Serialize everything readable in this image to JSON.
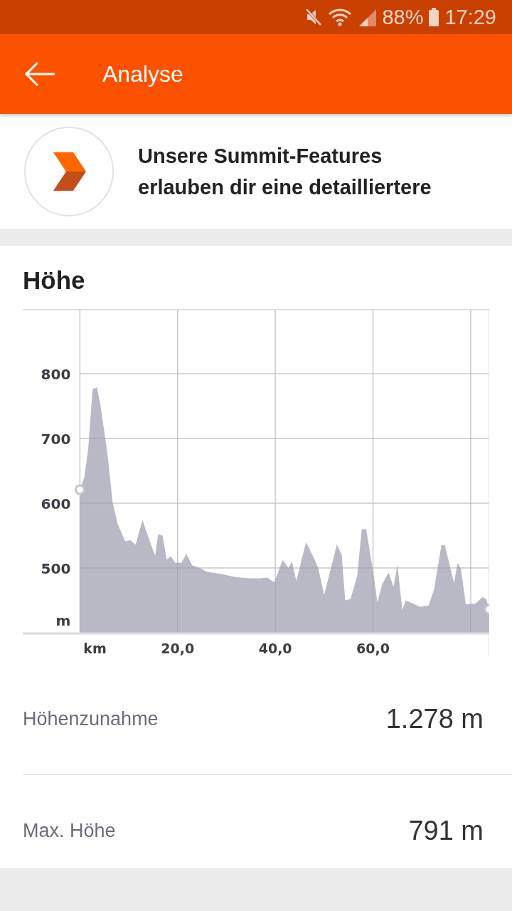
{
  "status_bar": {
    "battery": "88%",
    "time": "17:29"
  },
  "app_bar": {
    "title": "Analyse"
  },
  "promo": {
    "text": "Unsere Summit-Features erlauben dir eine detailliertere"
  },
  "elevation": {
    "title": "Höhe",
    "chart_data": {
      "type": "area",
      "xlabel": "km",
      "ylabel": "m",
      "grid": true,
      "xlim": [
        -11.7,
        83.8
      ],
      "ylim": [
        400,
        900
      ],
      "xticks": [
        {
          "value": 20,
          "label": "20,0"
        },
        {
          "value": 40,
          "label": "40,0"
        },
        {
          "value": 60,
          "label": "60,0"
        }
      ],
      "yticks": [
        500,
        600,
        700,
        800
      ],
      "x": [
        0,
        0.9,
        1.7,
        2.6,
        3.5,
        4.2,
        5.7,
        6.7,
        7.7,
        9.3,
        10.3,
        11.4,
        12.8,
        14.6,
        15.4,
        16,
        16.9,
        17.8,
        18.6,
        19.5,
        20.8,
        21.8,
        23,
        24.5,
        26,
        28.8,
        31.8,
        34.7,
        36.9,
        38.3,
        39.8,
        41.5,
        42.7,
        43.4,
        44.3,
        46.3,
        47.8,
        48.8,
        50,
        52.6,
        53.6,
        54.3,
        55.4,
        56.8,
        57.7,
        58.6,
        60.2,
        60.9,
        61.9,
        63.2,
        64.2,
        65,
        66,
        66.7,
        69.6,
        71.4,
        72.5,
        74,
        74.7,
        76.6,
        77.3,
        78,
        79,
        81,
        82.4,
        83.2,
        83.8
      ],
      "series": [
        {
          "color": "#b9b9c6",
          "values": [
            621,
            640,
            684,
            776,
            779,
            752,
            673,
            601,
            568,
            541,
            543,
            536,
            574,
            535,
            519,
            552,
            550,
            513,
            518,
            508,
            508,
            522,
            504,
            500,
            494,
            491,
            486,
            484,
            484,
            485,
            478,
            512,
            500,
            510,
            480,
            540,
            517,
            500,
            458,
            536,
            520,
            450,
            452,
            489,
            560,
            560,
            486,
            447,
            475,
            493,
            471,
            505,
            435,
            450,
            440,
            442,
            467,
            535,
            535,
            477,
            507,
            499,
            444,
            445,
            455,
            452,
            436
          ]
        }
      ]
    }
  },
  "stats": [
    {
      "label": "Höhenzunahme",
      "value": "1.278 m"
    },
    {
      "label": "Max. Höhe",
      "value": "791 m"
    }
  ]
}
